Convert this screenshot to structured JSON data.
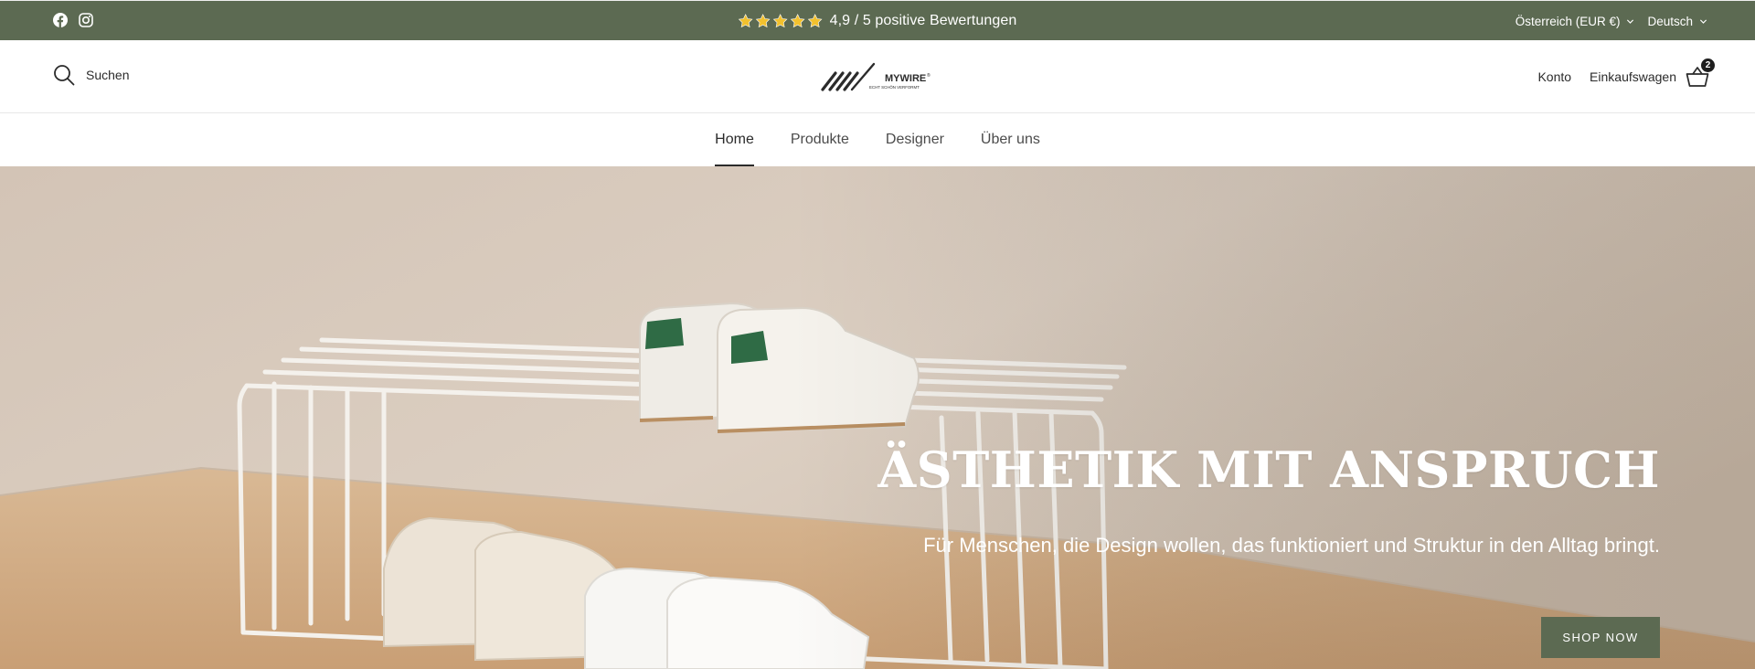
{
  "announcement": {
    "rating_text": "4,9 / 5 positive Bewertungen",
    "stars": 5,
    "social_icons": [
      "facebook-icon",
      "instagram-icon"
    ],
    "country_selector": "Österreich (EUR €)",
    "language_selector": "Deutsch"
  },
  "header": {
    "search_label": "Suchen",
    "logo": {
      "brand": "MYWIRE",
      "tagline": "ECHT SCHÖN VERFORMT"
    },
    "account_label": "Konto",
    "cart_label": "Einkaufswagen",
    "cart_count": "2"
  },
  "nav": {
    "items": [
      {
        "label": "Home",
        "active": true
      },
      {
        "label": "Produkte",
        "active": false
      },
      {
        "label": "Designer",
        "active": false
      },
      {
        "label": "Über uns",
        "active": false
      }
    ]
  },
  "hero": {
    "title": "ÄSTHETIK MIT ANSPRUCH",
    "subtitle": "Für Menschen, die Design wollen, das funktioniert und Struktur in den Alltag bringt.",
    "cta_label": "SHOP NOW"
  },
  "colors": {
    "brand_green": "#5c6a52",
    "hero_wall": "#d9cbbd",
    "hero_floor": "#d6b48f",
    "star": "#f2c12e"
  }
}
